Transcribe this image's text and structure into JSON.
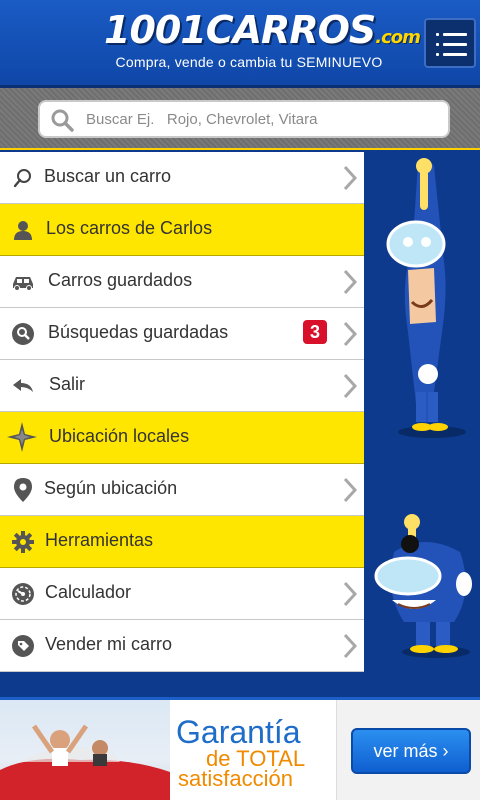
{
  "header": {
    "logo_main": "1001CARROS",
    "logo_suffix": ".com",
    "tagline": "Compra, vende o cambia tu SEMINUEVO",
    "menu_icon": "hamburger-menu-icon"
  },
  "search": {
    "placeholder": "Buscar Ej.   Rojo, Chevrolet, Vitara",
    "icon": "search-icon"
  },
  "menu": {
    "items": [
      {
        "label": "Buscar un carro",
        "icon": "search-icon",
        "type": "item"
      },
      {
        "label": "Los carros de Carlos",
        "icon": "user-icon",
        "type": "section"
      },
      {
        "label": "Carros guardados",
        "icon": "car-icon",
        "type": "item"
      },
      {
        "label": "Búsquedas guardadas",
        "icon": "magnifier-circle-icon",
        "type": "item",
        "badge": "3"
      },
      {
        "label": "Salir",
        "icon": "back-arrow-icon",
        "type": "item"
      },
      {
        "label": "Ubicación locales",
        "icon": "compass-star-icon",
        "type": "section"
      },
      {
        "label": "Según ubicación",
        "icon": "location-pin-icon",
        "type": "item"
      },
      {
        "label": "Herramientas",
        "icon": "gear-icon",
        "type": "section"
      },
      {
        "label": "Calculador",
        "icon": "gauge-icon",
        "type": "item"
      },
      {
        "label": "Vender mi carro",
        "icon": "tag-icon",
        "type": "item"
      }
    ]
  },
  "ad": {
    "line1": "Garantía",
    "line2": "de TOTAL",
    "line3": "satisfacción",
    "button": "ver más ›"
  },
  "colors": {
    "header_blue": "#1a5bc4",
    "section_yellow": "#ffe600",
    "side_blue": "#0d3a8c",
    "badge_red": "#d9102a",
    "ad_blue": "#1e6dc8",
    "ad_orange": "#f08a00"
  }
}
